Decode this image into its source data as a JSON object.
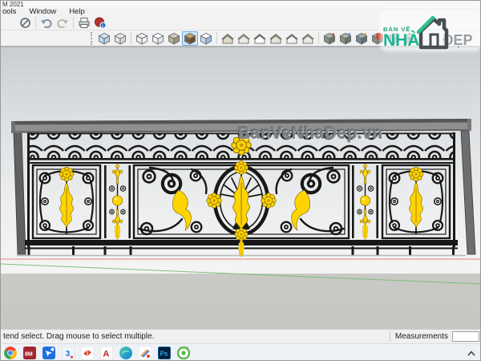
{
  "window": {
    "title_fragment": "M 2021"
  },
  "menu_bar": {
    "items": [
      {
        "label": "ools"
      },
      {
        "label": "Window"
      },
      {
        "label": "Help"
      }
    ]
  },
  "toolbars": {
    "row1_icons": [
      "erase-icon",
      "undo-icon",
      "redo-icon",
      "print-icon",
      "model-info-icon"
    ],
    "row2_style_icons": [
      "xray-icon",
      "back-edges-icon",
      "wireframe-icon",
      "hidden-line-icon",
      "shaded-icon",
      "shaded-with-textures-icon",
      "monochrome-icon"
    ],
    "row2_selected_style": "shaded-with-textures-icon",
    "row2_view_icons": [
      "iso-view-icon",
      "top-view-icon",
      "front-view-icon",
      "right-view-icon",
      "back-view-icon",
      "left-view-icon"
    ],
    "row2_extra_icons": [
      "component-tool-icon-1",
      "component-tool-icon-2",
      "component-tool-icon-3",
      "component-tool-icon-4",
      "component-tool-icon-5",
      "component-tool-icon-6"
    ]
  },
  "canvas": {
    "watermark_text": "BanVeNhaDep.vn",
    "subject": "Ornate wrought-iron balcony railing with gold leaf ornaments",
    "colors": {
      "iron": "#1a1a1a",
      "gold": "#ffd400",
      "rail_gray": "#8a8a8a",
      "sky_top": "#c9ced2",
      "ground": "#c9c9c6",
      "axis_red": "#e8837d",
      "axis_green": "#7cbf7c"
    }
  },
  "logo": {
    "top_text": "BẢN VẼ",
    "main_text": "NHÀ",
    "suffix_text": "ĐẸP",
    "green": "#1fa06b",
    "teal": "#14b493",
    "gray": "#979da3"
  },
  "status_bar": {
    "hint": "tend select. Drag mouse to select multiple.",
    "measurements_label": "Measurements",
    "measurements_value": ""
  },
  "taskbar": {
    "icons": [
      "chrome-icon",
      "red-media-app-icon",
      "blue-share-app-icon",
      "app-3-icon",
      "sketchup-icon",
      "autocad-icon",
      "edge-icon",
      "paint-app-icon",
      "photoshop-icon",
      "coccoc-icon"
    ],
    "active_icons": [
      "sketchup-icon",
      "paint-app-icon",
      "coccoc-icon"
    ],
    "overflow_chevron": "^"
  }
}
